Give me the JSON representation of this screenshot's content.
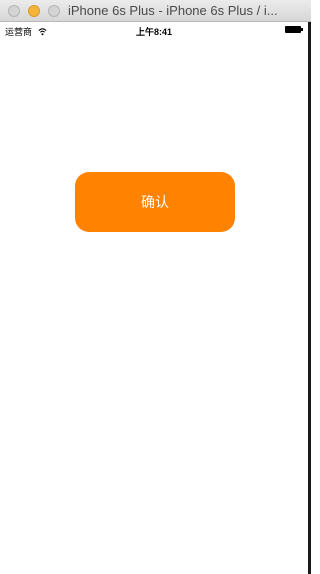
{
  "window": {
    "title": "iPhone 6s Plus - iPhone 6s Plus / i..."
  },
  "status_bar": {
    "carrier": "运营商",
    "time": "上午8:41",
    "icons": [
      "wifi-icon",
      "battery-icon"
    ]
  },
  "main": {
    "confirm_label": "确认"
  },
  "colors": {
    "button_background": "#ff8200",
    "button_text": "#ffffff",
    "page_background": "#ffffff"
  }
}
